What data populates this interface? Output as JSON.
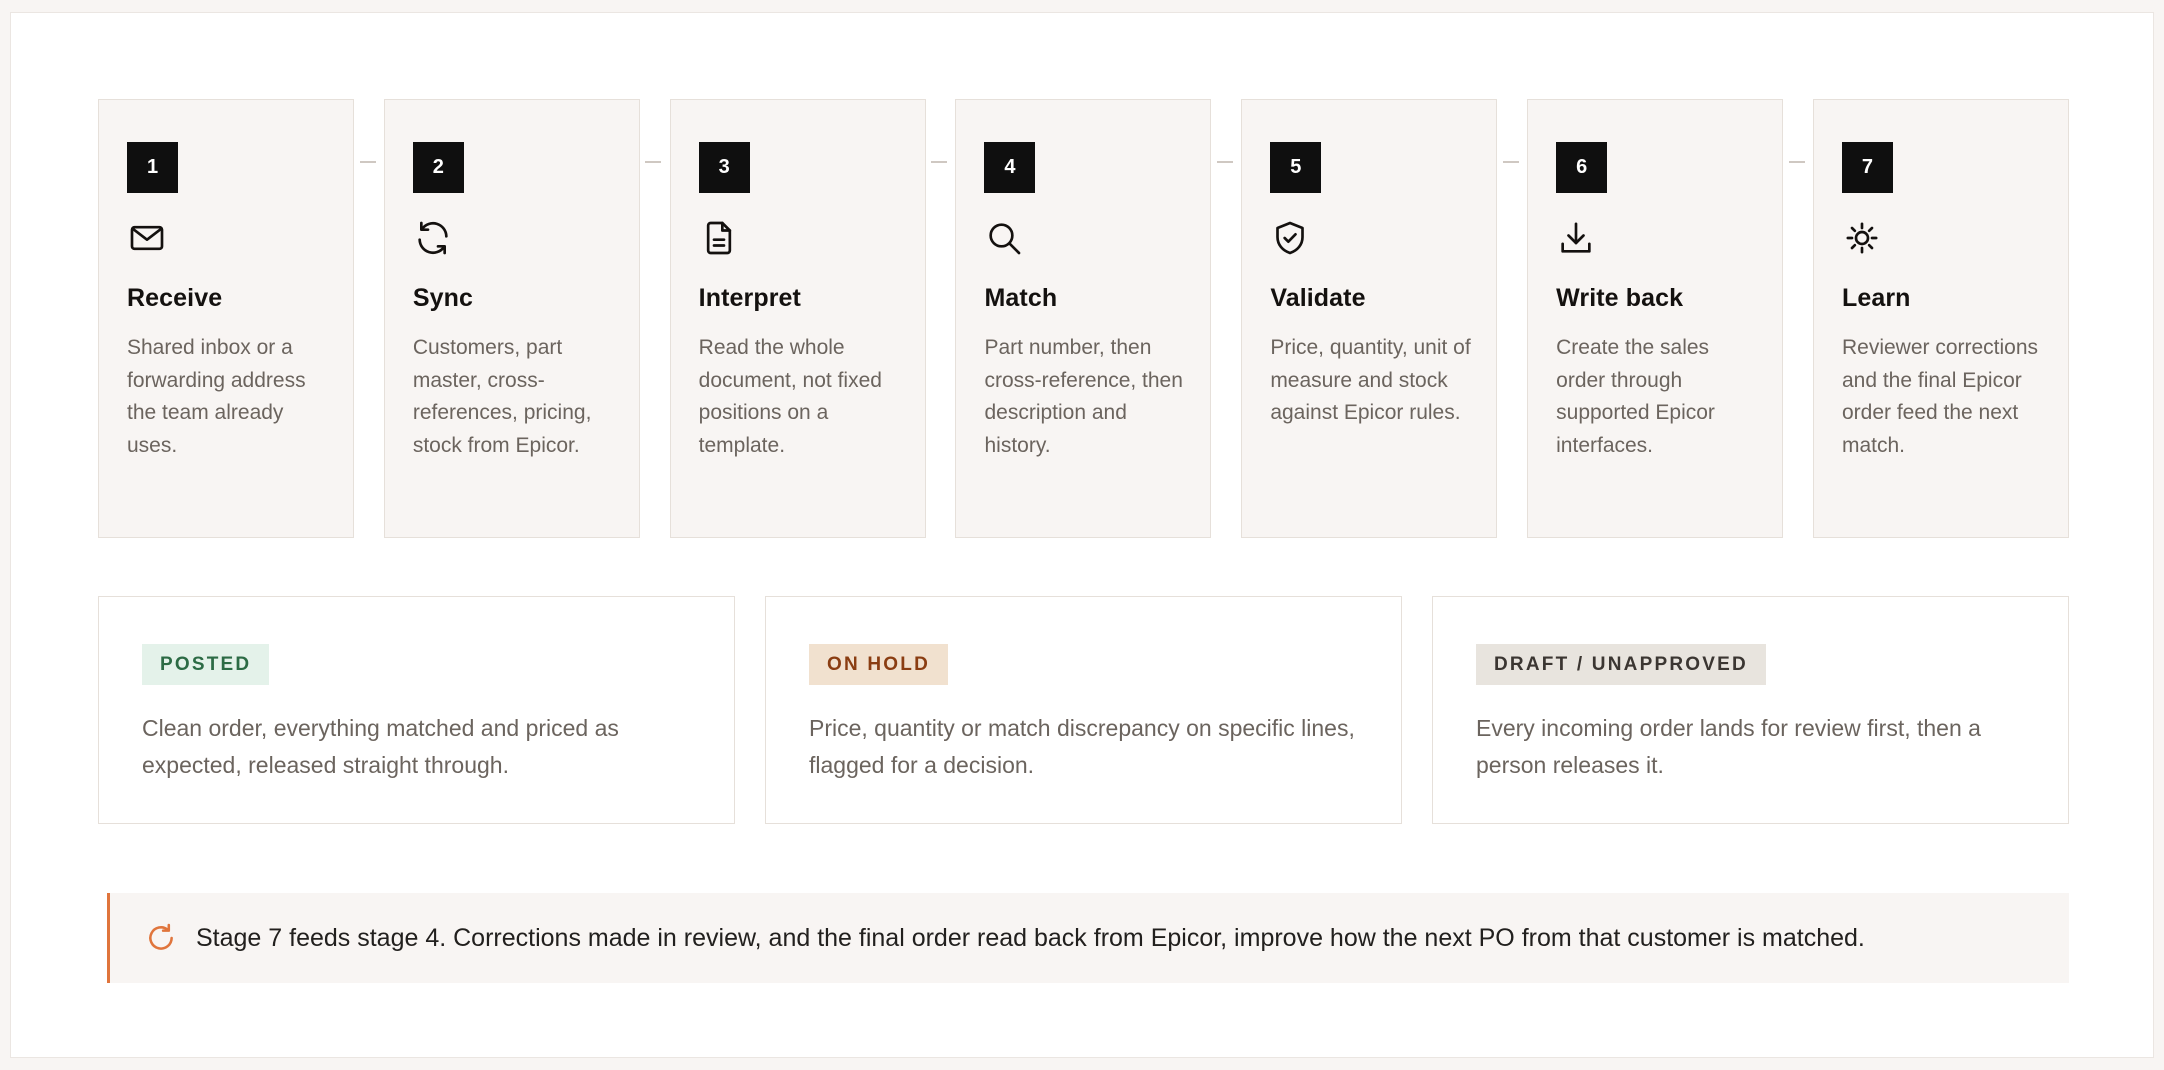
{
  "steps": [
    {
      "number": "1",
      "icon": "mail-icon",
      "title": "Receive",
      "description": "Shared inbox or a forwarding address the team already uses."
    },
    {
      "number": "2",
      "icon": "sync-icon",
      "title": "Sync",
      "description": "Customers, part master, cross-references, pricing, stock from Epicor."
    },
    {
      "number": "3",
      "icon": "document-icon",
      "title": "Interpret",
      "description": "Read the whole document, not fixed positions on a template."
    },
    {
      "number": "4",
      "icon": "search-icon",
      "title": "Match",
      "description": "Part number, then cross-reference, then description and history."
    },
    {
      "number": "5",
      "icon": "shield-check-icon",
      "title": "Validate",
      "description": "Price, quantity, unit of measure and stock against Epicor rules."
    },
    {
      "number": "6",
      "icon": "download-icon",
      "title": "Write back",
      "description": "Create the sales order through supported Epicor interfaces."
    },
    {
      "number": "7",
      "icon": "sun-icon",
      "title": "Learn",
      "description": "Reviewer corrections and the final Epicor order feed the next match."
    }
  ],
  "statuses": [
    {
      "label": "POSTED",
      "description": "Clean order, everything matched and priced as expected, released straight through.",
      "badge_bg": "#e4f2ea",
      "badge_color": "#2c6b45"
    },
    {
      "label": "ON HOLD",
      "description": "Price, quantity or match discrepancy on specific lines, flagged for a decision.",
      "badge_bg": "#f1e1cf",
      "badge_color": "#8a3d12"
    },
    {
      "label": "DRAFT / UNAPPROVED",
      "description": "Every incoming order lands for review first, then a person releases it.",
      "badge_bg": "#e8e4de",
      "badge_color": "#3b3632"
    }
  ],
  "note": {
    "icon": "refresh-icon",
    "text": "Stage 7 feeds stage 4. Corrections made in review, and the final order read back from Epicor, improve how the next PO from that customer is matched.",
    "accent_color": "#e0753c"
  }
}
